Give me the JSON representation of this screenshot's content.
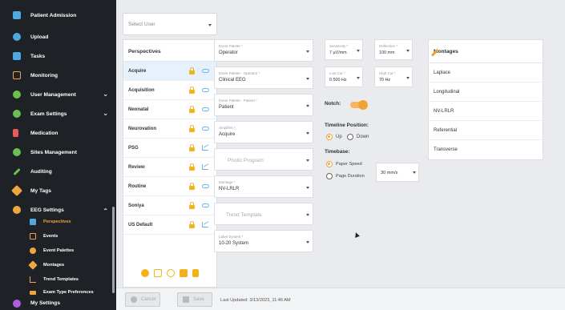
{
  "sidebar": {
    "items": [
      {
        "label": "Patient Admission",
        "icon": "patient-admission-icon",
        "color": "#4fa8e0"
      },
      {
        "label": "Upload",
        "icon": "upload-cloud-icon",
        "color": "#4fa8e0"
      },
      {
        "label": "Tasks",
        "icon": "tasks-icon",
        "color": "#4fa8e0"
      },
      {
        "label": "Monitoring",
        "icon": "monitor-icon",
        "color": "#f0a640"
      },
      {
        "label": "User Management",
        "icon": "users-icon",
        "color": "#6bbf4e"
      },
      {
        "label": "Exam Settings",
        "icon": "gear-icon",
        "color": "#6bbf4e"
      },
      {
        "label": "Medication",
        "icon": "medication-icon",
        "color": "#e85a5a"
      },
      {
        "label": "Sites Management",
        "icon": "globe-icon",
        "color": "#6bbf4e"
      },
      {
        "label": "Auditing",
        "icon": "pen-icon",
        "color": "#6bbf4e"
      },
      {
        "label": "My Tags",
        "icon": "tag-icon",
        "color": "#f0a640"
      },
      {
        "label": "EEG Settings",
        "icon": "gear-icon",
        "color": "#f0a640"
      }
    ],
    "sub_items": [
      {
        "label": "Perspectives",
        "icon": "perspectives-icon",
        "color": "#4fa8e0"
      },
      {
        "label": "Events",
        "icon": "events-icon",
        "color": "#f0a640"
      },
      {
        "label": "Event Palettes",
        "icon": "palette-icon",
        "color": "#f0a640"
      },
      {
        "label": "Montages",
        "icon": "montage-icon",
        "color": "#f0a640"
      },
      {
        "label": "Trend Templates",
        "icon": "trend-icon",
        "color": "#f0a640"
      },
      {
        "label": "Exam Type Preferences",
        "icon": "exam-type-icon",
        "color": "#f0a640"
      }
    ],
    "bottom_item": {
      "label": "My Settings",
      "icon": "user-settings-icon",
      "color": "#b05fd8"
    }
  },
  "select_user": {
    "placeholder": "Select User"
  },
  "perspectives": {
    "title": "Perspectives",
    "rows": [
      "Acquire",
      "Acquisition",
      "Neonatal",
      "Neurovation",
      "PSG",
      "Review",
      "Routine",
      "Soniya",
      "US Default"
    ]
  },
  "fields": {
    "event_palette": {
      "label": "Event Palette *",
      "value": "Operator"
    },
    "event_palette_operator": {
      "label": "Event Palette - Operator *",
      "value": "Clinical EEG"
    },
    "event_palette_patient": {
      "label": "Event Palette - Patient *",
      "value": "Patient"
    },
    "amplifier": {
      "label": "Amplifier *",
      "value": "Acquire"
    },
    "photic_program": {
      "placeholder": "Photic Program"
    },
    "montage": {
      "label": "Montage *",
      "value": "NV-LRLR"
    },
    "trend_template": {
      "placeholder": "Trend Template"
    },
    "label_system": {
      "label": "Label System *",
      "value": "10-20 System"
    },
    "sensitivity": {
      "label": "Sensitivity *",
      "value": "7 µV/mm"
    },
    "deflection": {
      "label": "Deflection *",
      "value": "100 mm"
    },
    "low_cut": {
      "label": "Low Cut *",
      "value": "0.500 Hz"
    },
    "high_cut": {
      "label": "High Cut *",
      "value": "70 Hz"
    },
    "paper_speed": {
      "value": "30 mm/s"
    }
  },
  "settings": {
    "notch_label": "Notch:",
    "timeline_label": "Timeline Position:",
    "timeline_up": "Up",
    "timeline_down": "Down",
    "timebase_label": "Timebase:",
    "timebase_paper": "Paper Speed",
    "timebase_page": "Page Duration"
  },
  "montages": {
    "title": "Montages",
    "rows": [
      "Laplace",
      "Longitudinal",
      "NV-LRLR",
      "Referential",
      "Transverse"
    ]
  },
  "footer": {
    "cancel_label": "Cancel",
    "save_label": "Save",
    "last_updated": "Last Updated: 3/13/2023, 11:46 AM"
  }
}
